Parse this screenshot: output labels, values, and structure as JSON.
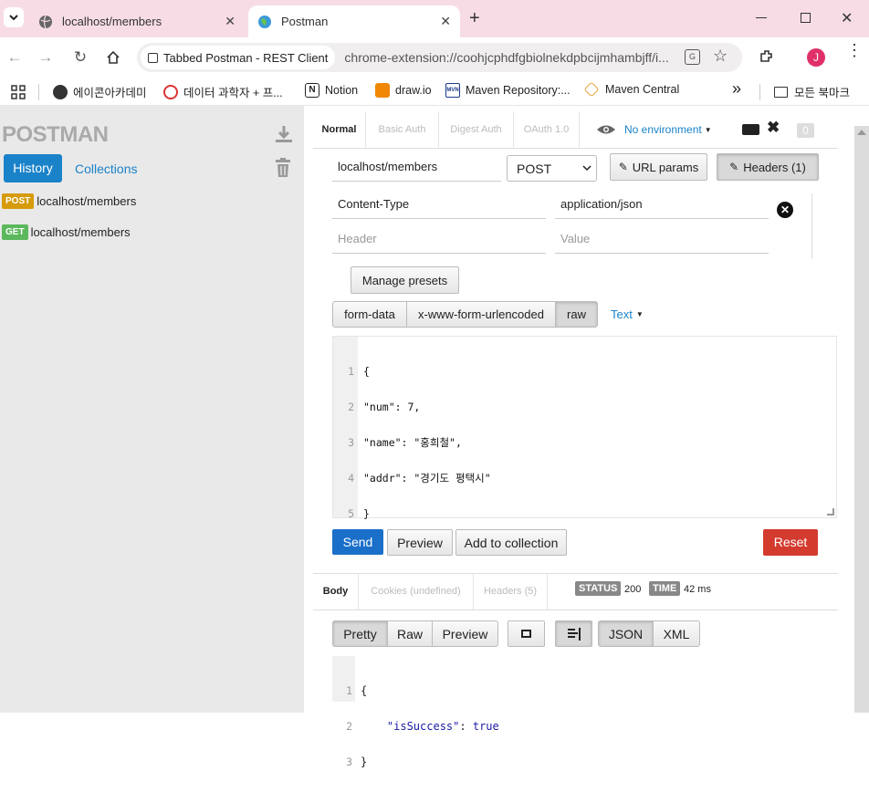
{
  "browser": {
    "tabs": [
      {
        "title": "localhost/members"
      },
      {
        "title": "Postman"
      }
    ],
    "new_tab_symbol": "+",
    "url_chip": "Tabbed Postman - REST Client",
    "url": "chrome-extension://coohjcphdfgbiolnekdpbcijmhambjff/i...",
    "profile_initial": "J",
    "bookmarks": [
      {
        "label": "에이콘아카데미"
      },
      {
        "label": "데이터 과학자 + 프..."
      },
      {
        "label": "Notion"
      },
      {
        "label": "draw.io"
      },
      {
        "label": "Maven Repository:..."
      },
      {
        "label": "Maven Central"
      }
    ],
    "bookmarks_more": "»",
    "all_bookmarks": "모든 북마크"
  },
  "sidebar": {
    "logo": "POSTMAN",
    "tab_history": "History",
    "tab_collections": "Collections",
    "history": [
      {
        "method": "POST",
        "url": "localhost/members",
        "color": "#d69b0a"
      },
      {
        "method": "GET",
        "url": "localhost/members",
        "color": "#5cb85c"
      }
    ]
  },
  "request": {
    "modes": [
      "Normal",
      "Basic Auth",
      "Digest Auth",
      "OAuth 1.0"
    ],
    "environment": "No environment",
    "badge_count": "0",
    "url": "localhost/members",
    "method": "POST",
    "url_params_label": "URL params",
    "headers_label": "Headers (1)",
    "headers": [
      {
        "key": "Content-Type",
        "value": "application/json"
      }
    ],
    "header_placeholder": "Header",
    "value_placeholder": "Value",
    "manage_presets": "Manage presets",
    "body_modes": [
      "form-data",
      "x-www-form-urlencoded",
      "raw"
    ],
    "body_format": "Text",
    "body_lines": [
      "{",
      "\"num\": 7,",
      "\"name\": \"홍희철\",",
      "\"addr\": \"경기도 평택시\"",
      "}"
    ],
    "line_numbers": [
      "1",
      "2",
      "3",
      "4",
      "5"
    ],
    "send": "Send",
    "preview": "Preview",
    "add_to_collection": "Add to collection",
    "reset": "Reset"
  },
  "response": {
    "tabs": [
      "Body",
      "Cookies (undefined)",
      "Headers (5)"
    ],
    "status_label": "STATUS",
    "status_value": "200",
    "time_label": "TIME",
    "time_value": "42 ms",
    "view_modes": [
      "Pretty",
      "Raw",
      "Preview"
    ],
    "formats": [
      "JSON",
      "XML"
    ],
    "line_numbers": [
      "1",
      "2",
      "3"
    ],
    "lines": [
      {
        "text": "{"
      },
      {
        "key": "\"isSuccess\"",
        "sep": ": ",
        "value": "true"
      },
      {
        "text": "}"
      }
    ]
  },
  "colors": {
    "accent": "#1a82c9",
    "send": "#1a6fc9",
    "reset": "#d33b2f",
    "tabstrip": "#f7dce6"
  }
}
